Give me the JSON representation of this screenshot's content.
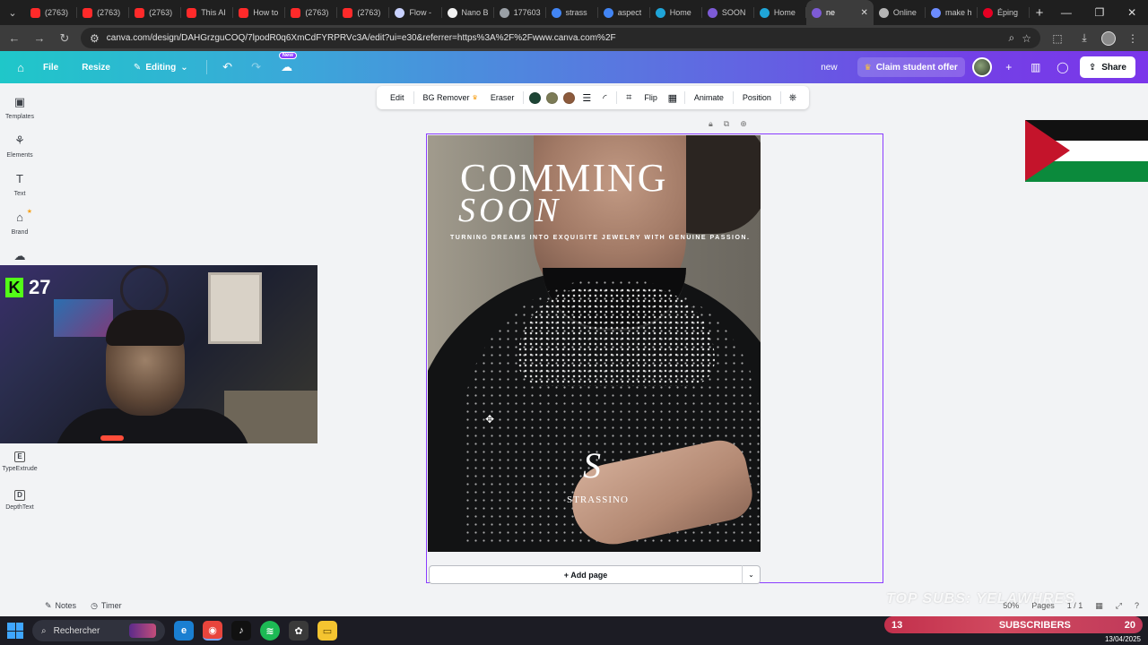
{
  "browser": {
    "tabs": [
      {
        "label": "(2763)",
        "favicon": "youtube-icon",
        "color": "#ff2a2a"
      },
      {
        "label": "(2763)",
        "favicon": "youtube-icon",
        "color": "#ff2a2a"
      },
      {
        "label": "(2763)",
        "favicon": "youtube-icon",
        "color": "#ff2a2a"
      },
      {
        "label": "This AI",
        "favicon": "youtube-icon",
        "color": "#ff2a2a"
      },
      {
        "label": "How to",
        "favicon": "youtube-icon",
        "color": "#ff2a2a"
      },
      {
        "label": "(2763)",
        "favicon": "youtube-icon",
        "color": "#ff2a2a"
      },
      {
        "label": "(2763)",
        "favicon": "youtube-icon",
        "color": "#ff2a2a"
      },
      {
        "label": "Flow -",
        "favicon": "flow-icon",
        "color": "#c9d2ff"
      },
      {
        "label": "Nano B",
        "favicon": "nano-icon",
        "color": "#f2f2f2"
      },
      {
        "label": "177603",
        "favicon": "globe-icon",
        "color": "#9aa0a6"
      },
      {
        "label": "strass",
        "favicon": "google-icon",
        "color": "#4285f4"
      },
      {
        "label": "aspect",
        "favicon": "google-icon",
        "color": "#4285f4"
      },
      {
        "label": "Home",
        "favicon": "canva-icon",
        "color": "#1fa5d8"
      },
      {
        "label": "SOON",
        "favicon": "canva-heart-icon",
        "color": "#7d5bd6"
      },
      {
        "label": "Home",
        "favicon": "canva-icon",
        "color": "#1fa5d8"
      },
      {
        "label": "ne",
        "favicon": "canva-heart-icon",
        "color": "#7d5bd6",
        "active": true
      },
      {
        "label": "Online",
        "favicon": "online-icon",
        "color": "#b5b5b5"
      },
      {
        "label": "make h",
        "favicon": "gemini-icon",
        "color": "#6c8cff"
      },
      {
        "label": "Éping",
        "favicon": "pinterest-icon",
        "color": "#e60023"
      }
    ],
    "url": "canva.com/design/DAHGrzguCOQ/7lpodR0q6XmCdFYRPRVc3A/edit?ui=e30&referrer=https%3A%2F%2Fwww.canva.com%2F"
  },
  "canva_header": {
    "file_label": "File",
    "resize_label": "Resize",
    "editing_label": "Editing",
    "new_badge": "New",
    "doc_name": "new",
    "claim_label": "Claim student offer",
    "share_label": "Share"
  },
  "sidebar": {
    "items": [
      {
        "label": "Templates",
        "icon": "templates-icon"
      },
      {
        "label": "Elements",
        "icon": "elements-icon"
      },
      {
        "label": "Text",
        "icon": "text-icon"
      },
      {
        "label": "Brand",
        "icon": "brand-icon"
      }
    ],
    "extras": [
      {
        "label": "TypeExtrude",
        "glyph": "E"
      },
      {
        "label": "DepthText",
        "glyph": "D"
      }
    ]
  },
  "webcam": {
    "kick_count": "27"
  },
  "context_toolbar": {
    "edit_label": "Edit",
    "bg_remover_label": "BG Remover",
    "eraser_label": "Eraser",
    "swatches": [
      "#1d4535",
      "#7c7b56",
      "#8c5a3c"
    ],
    "flip_label": "Flip",
    "animate_label": "Animate",
    "position_label": "Position"
  },
  "design": {
    "title_line1": "COMMING",
    "title_line2": "SOON",
    "tagline": "TURNING DREAMS INTO EXQUISITE JEWELRY WITH GENUINE PASSION.",
    "monogram": "S",
    "brand": "STRASSINO"
  },
  "canvas": {
    "add_page_label": "+ Add page"
  },
  "flag": {
    "colors": [
      "#111111",
      "#ffffff",
      "#0b8a3c",
      "#c4142b"
    ]
  },
  "bottom": {
    "notes_label": "Notes",
    "timer_label": "Timer",
    "zoom": "50%",
    "pages": "Pages",
    "page_count": "1 / 1",
    "overlay": "TOP SUBS: YELAWHRES",
    "subs_count": "13",
    "subs_label": "SUBSCRIBERS",
    "subs_value": "20"
  },
  "taskbar": {
    "search_label": "Rechercher",
    "date": "13/04/2025"
  }
}
